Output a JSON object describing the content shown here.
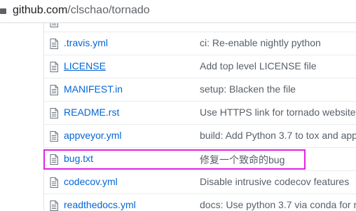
{
  "address_bar": {
    "host": "github.com",
    "path": "/clschao/tornado"
  },
  "files": [
    {
      "name": "",
      "message": "",
      "underlined": false,
      "icon": "file-icon"
    },
    {
      "name": ".travis.yml",
      "message": "ci: Re-enable nightly python",
      "underlined": false,
      "icon": "file-icon"
    },
    {
      "name": "LICENSE",
      "message": "Add top level LICENSE file",
      "underlined": true,
      "icon": "file-icon"
    },
    {
      "name": "MANIFEST.in",
      "message": "setup: Blacken the file",
      "underlined": false,
      "icon": "file-icon"
    },
    {
      "name": "README.rst",
      "message": "Use HTTPS link for tornado website.",
      "underlined": false,
      "icon": "file-icon"
    },
    {
      "name": "appveyor.yml",
      "message": "build: Add Python 3.7 to tox and app",
      "underlined": false,
      "icon": "file-icon"
    },
    {
      "name": "bug.txt",
      "message": "修复一个致命的bug",
      "underlined": false,
      "icon": "file-icon"
    },
    {
      "name": "codecov.yml",
      "message": "Disable intrusive codecov features",
      "underlined": false,
      "icon": "file-icon"
    },
    {
      "name": "readthedocs.yml",
      "message": "docs: Use python 3.7 via conda for re",
      "underlined": false,
      "icon": "file-icon"
    }
  ],
  "highlight": {
    "color": "#e321e3",
    "target_file": "bug.txt"
  },
  "colors": {
    "link": "#0366d6",
    "message": "#586069",
    "border": "#eaecef"
  }
}
